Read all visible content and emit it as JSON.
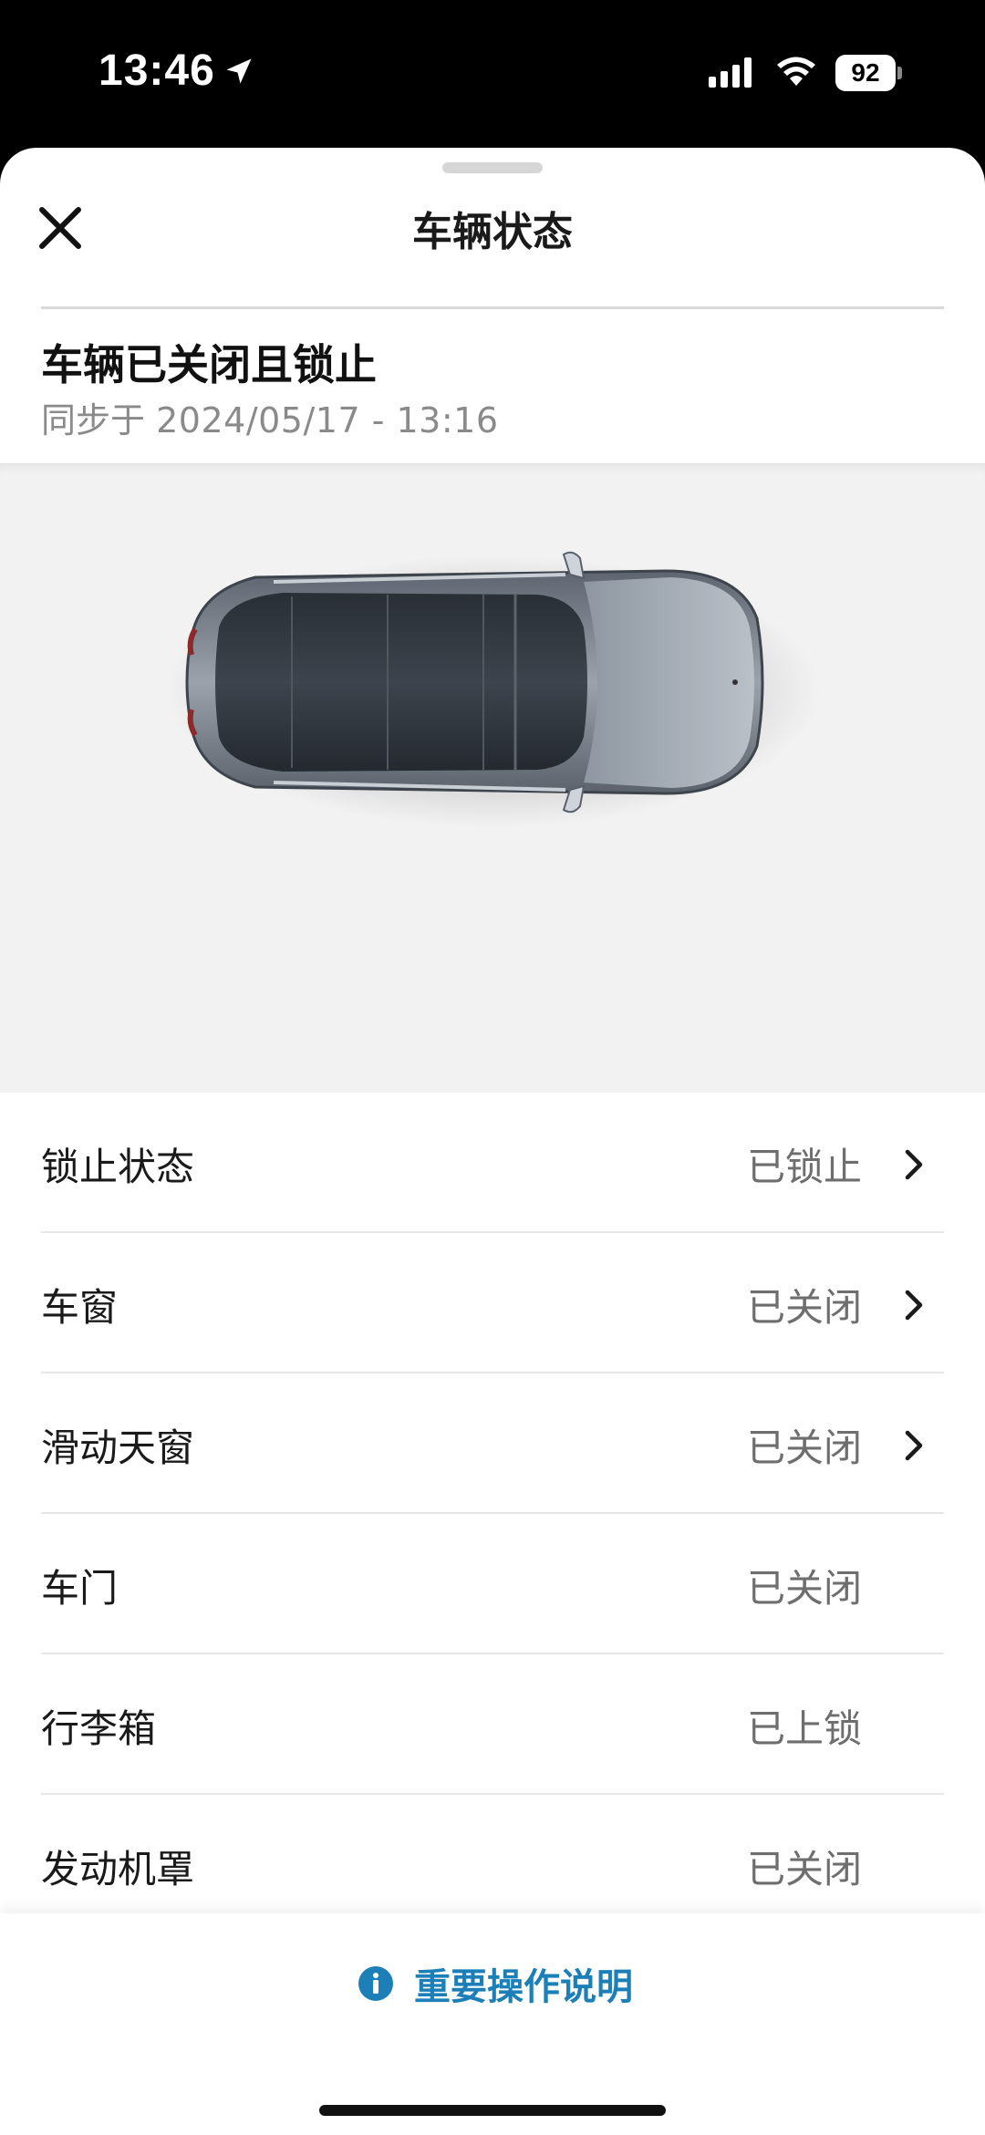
{
  "status_bar": {
    "time": "13:46",
    "battery": "92"
  },
  "sheet": {
    "title": "车辆状态",
    "status_heading": "车辆已关闭且锁止",
    "sync_prefix": "同步于",
    "sync_time": "2024/05/17 - 13:16"
  },
  "rows": [
    {
      "label": "锁止状态",
      "value": "已锁止",
      "has_chevron": true
    },
    {
      "label": "车窗",
      "value": "已关闭",
      "has_chevron": true
    },
    {
      "label": "滑动天窗",
      "value": "已关闭",
      "has_chevron": true
    },
    {
      "label": "车门",
      "value": "已关闭",
      "has_chevron": false
    },
    {
      "label": "行李箱",
      "value": "已上锁",
      "has_chevron": false
    },
    {
      "label": "发动机罩",
      "value": "已关闭",
      "has_chevron": false
    }
  ],
  "footer": {
    "info_label": "重要操作说明"
  },
  "colors": {
    "accent": "#1c7fb8",
    "value_text": "#6e6e6e",
    "car_area_bg": "#f2f2f2"
  }
}
